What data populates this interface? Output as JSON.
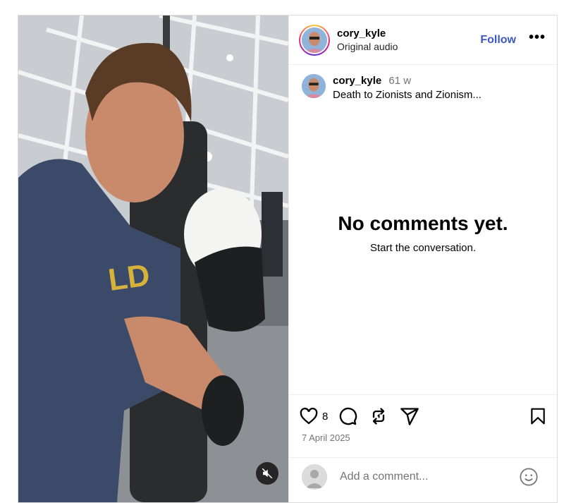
{
  "post": {
    "username": "cory_kyle",
    "audio": "Original audio",
    "follow_label": "Follow",
    "more_label": "•••",
    "caption": {
      "username": "cory_kyle",
      "time_ago": "61 w",
      "text": "Death to Zionists and Zionism..."
    },
    "empty_state": {
      "title": "No comments yet.",
      "subtitle": "Start the conversation."
    },
    "likes": "8",
    "date": "7 April 2025",
    "comment_placeholder": "Add a comment..."
  },
  "icons": {
    "like": "heart-icon",
    "comment": "comment-icon",
    "repost": "repost-icon",
    "share": "share-icon",
    "save": "bookmark-icon",
    "emoji": "emoji-icon",
    "mute": "muted-speaker-icon"
  },
  "colors": {
    "follow": "#3a57c5",
    "muted_text": "#737373",
    "border": "#dbdbdb"
  }
}
